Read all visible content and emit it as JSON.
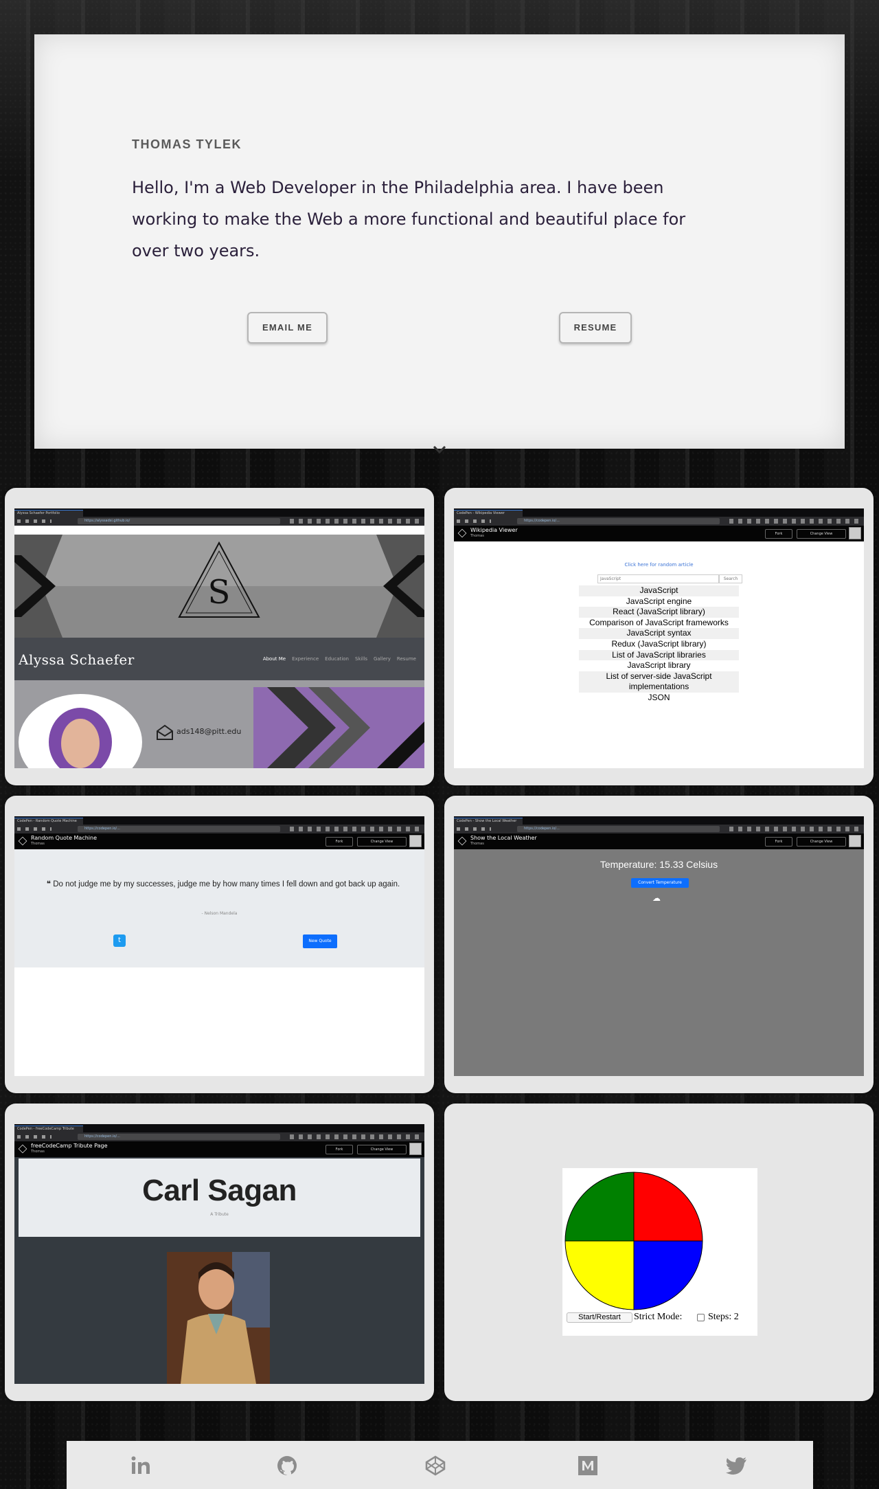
{
  "hero": {
    "name": "THOMAS TYLEK",
    "intro": "Hello, I'm a Web Developer in the Philadelphia area. I have been working to make the Web a more functional and beautiful place for over two years.",
    "email_label": "EMAIL ME",
    "resume_label": "RESUME"
  },
  "projects": {
    "portfolio": {
      "tab": "Alyssa Schaefer Portfolio",
      "url": "https://alyssadsi.github.io/",
      "name": "Alyssa Schaefer",
      "nav": [
        "About Me",
        "Experience",
        "Education",
        "Skills",
        "Gallery",
        "Resume"
      ],
      "email": "ads148@pitt.edu"
    },
    "wiki": {
      "tab": "CodePen - Wikipedia Viewer",
      "url": "https://codepen.io/...",
      "title": "Wikipedia Viewer",
      "author": "Thomas",
      "random_link": "Click here for random article",
      "search_value": "JavaScript",
      "search_button": "Search",
      "results": [
        "JavaScript",
        "JavaScript engine",
        "React (JavaScript library)",
        "Comparison of JavaScript frameworks",
        "JavaScript syntax",
        "Redux (JavaScript library)",
        "List of JavaScript libraries",
        "JavaScript library",
        "List of server-side JavaScript implementations",
        "JSON"
      ]
    },
    "quote": {
      "tab": "CodePen - Random Quote Machine",
      "title": "Random Quote Machine",
      "author": "Thomas",
      "quote": "Do not judge me by my successes, judge me by how many times I fell down and got back up again.",
      "quote_author": "- Nelson Mandela",
      "new_quote": "New Quote"
    },
    "weather": {
      "tab": "CodePen - Show the Local Weather",
      "title": "Show the Local Weather",
      "author": "Thomas",
      "temperature": "Temperature:  15.33 Celsius",
      "convert": "Convert Temperature"
    },
    "tribute": {
      "tab": "CodePen - freeCodeCamp Tribute",
      "title": "freeCodeCamp Tribute Page",
      "author": "Thomas",
      "heading": "Carl Sagan",
      "subheading": "A Tribute"
    },
    "simon": {
      "start": "Start/Restart",
      "strict": "Strict Mode:",
      "steps": "Steps: 2",
      "colors": [
        "#008000",
        "#ff0000",
        "#ffff00",
        "#0000ff"
      ]
    }
  },
  "codepen": {
    "fork": "Fork",
    "change_view": "Change View"
  },
  "footer": {
    "icons": [
      "linkedin-icon",
      "github-icon",
      "codepen-icon",
      "medium-icon",
      "twitter-icon"
    ]
  }
}
